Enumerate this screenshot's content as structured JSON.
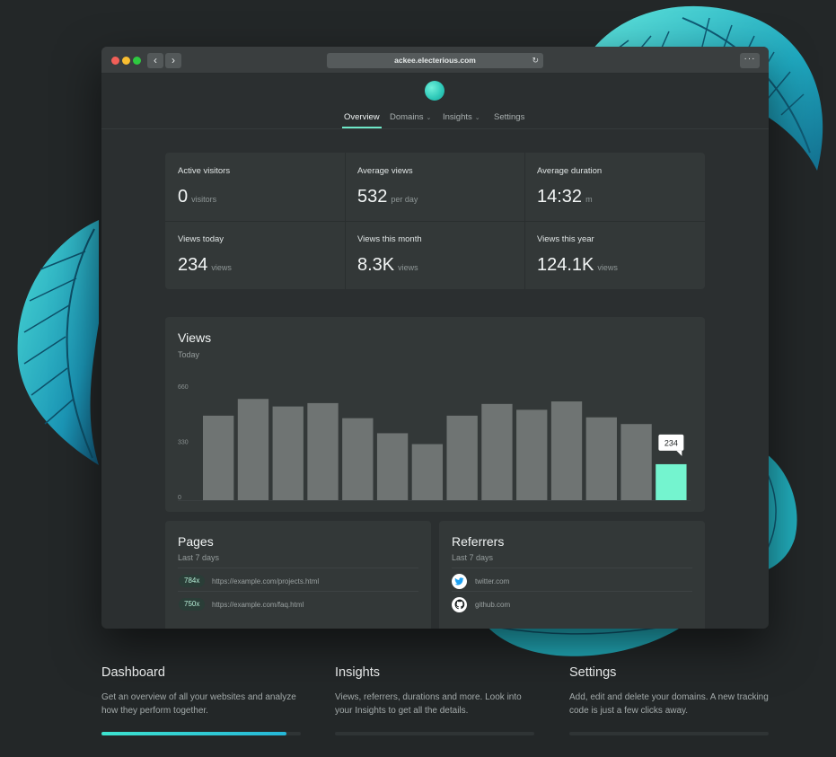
{
  "browser": {
    "url": "ackee.electerious.com",
    "back_icon": "‹",
    "forward_icon": "›",
    "reload_icon": "↻",
    "more_icon": "···"
  },
  "nav": {
    "items": [
      {
        "label": "Overview",
        "active": true
      },
      {
        "label": "Domains",
        "dropdown": true
      },
      {
        "label": "Insights",
        "dropdown": true
      },
      {
        "label": "Settings"
      }
    ],
    "chevron": "⌄"
  },
  "stats": [
    {
      "label": "Active visitors",
      "value": "0",
      "unit": "visitors"
    },
    {
      "label": "Average views",
      "value": "532",
      "unit": "per day"
    },
    {
      "label": "Average duration",
      "value": "14:32",
      "unit": "m"
    },
    {
      "label": "Views today",
      "value": "234",
      "unit": "views"
    },
    {
      "label": "Views this month",
      "value": "8.3K",
      "unit": "views"
    },
    {
      "label": "Views this year",
      "value": "124.1K",
      "unit": "views"
    }
  ],
  "views_card": {
    "title": "Views",
    "subtitle": "Today"
  },
  "chart_data": {
    "type": "bar",
    "title": "Views",
    "subtitle": "Today",
    "yticks": [
      "660",
      "330",
      "0"
    ],
    "ylim": [
      0,
      660
    ],
    "values": [
      505,
      605,
      560,
      580,
      490,
      400,
      335,
      505,
      575,
      540,
      590,
      495,
      455,
      215
    ],
    "highlight_index": 13,
    "tooltip": "234",
    "bar_color": "#6f7473",
    "highlight_color": "#74f4cf",
    "grid": false
  },
  "pages": {
    "title": "Pages",
    "subtitle": "Last 7 days",
    "rows": [
      {
        "count": "784x",
        "url": "https://example.com/projects.html"
      },
      {
        "count": "750x",
        "url": "https://example.com/faq.html"
      }
    ]
  },
  "referrers": {
    "title": "Referrers",
    "subtitle": "Last 7 days",
    "rows": [
      {
        "icon": "twitter-icon",
        "glyph": "🐦",
        "name": "twitter.com"
      },
      {
        "icon": "github-icon",
        "glyph": "●",
        "name": "github.com"
      }
    ]
  },
  "features": [
    {
      "title": "Dashboard",
      "text": "Get an overview of all your websites and analyze how they perform together.",
      "progress": 0.93
    },
    {
      "title": "Insights",
      "text": "Views, referrers, durations and more. Look into your Insights to get all the details.",
      "progress": 0
    },
    {
      "title": "Settings",
      "text": "Add, edit and delete your domains. A new tracking code is just a few clicks away.",
      "progress": 0
    }
  ],
  "colors": {
    "accent": "#6ee8c8",
    "leaf": "#2bc0c6",
    "background": "#232728"
  }
}
